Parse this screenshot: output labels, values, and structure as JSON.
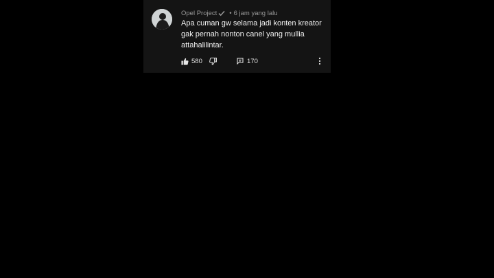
{
  "comment": {
    "author": "Opel Project",
    "verified_icon": "checkmark-icon",
    "separator": "•",
    "timestamp": "6 jam yang lalu",
    "text": "Apa cuman gw selama jadi konten kreator\ngak pernah nonton canel yang mullia\nattahalilintar.",
    "likes": "580",
    "replies": "170"
  },
  "icons": {
    "like": "thumbs-up-icon",
    "dislike": "thumbs-down-icon",
    "reply": "reply-icon",
    "more": "more-vertical-icon"
  },
  "colors": {
    "background": "#000000",
    "card": "#141414",
    "text": "#f1f1f1",
    "meta": "#9a9a9a"
  }
}
